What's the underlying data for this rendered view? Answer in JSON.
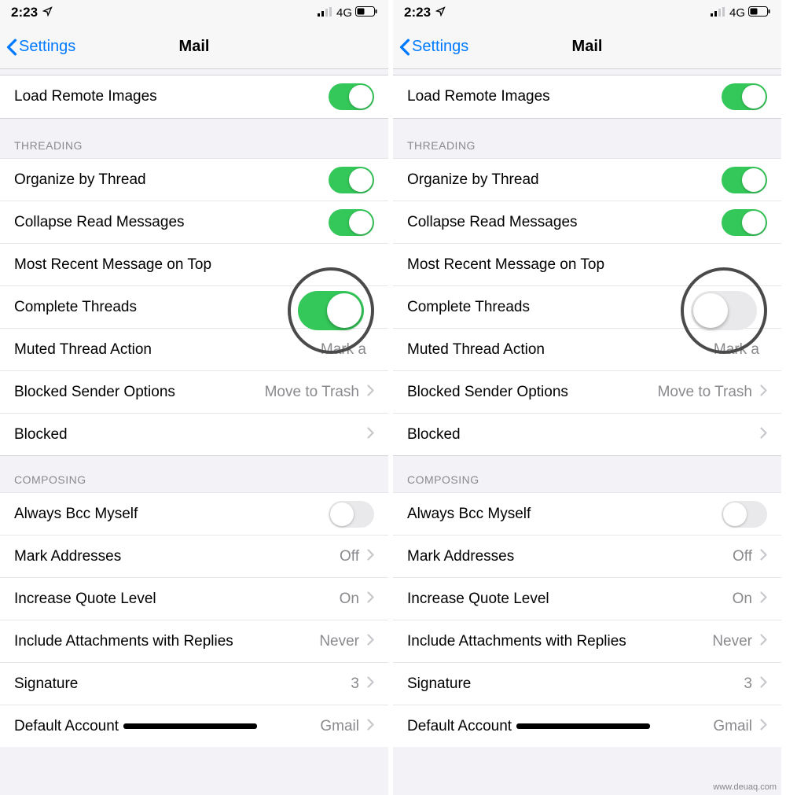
{
  "status": {
    "time": "2:23",
    "network": "4G"
  },
  "nav": {
    "back": "Settings",
    "title": "Mail"
  },
  "rows": {
    "load_remote": "Load Remote Images",
    "organize": "Organize by Thread",
    "collapse": "Collapse Read Messages",
    "most_recent": "Most Recent Message on Top",
    "complete": "Complete Threads",
    "muted": "Muted Thread Action",
    "muted_val": "Mark a",
    "blocked_sender": "Blocked Sender Options",
    "blocked_sender_val": "Move to Trash",
    "blocked": "Blocked",
    "bcc": "Always Bcc Myself",
    "mark_addr": "Mark Addresses",
    "mark_addr_val": "Off",
    "quote": "Increase Quote Level",
    "quote_val": "On",
    "attach": "Include Attachments with Replies",
    "attach_val": "Never",
    "sig": "Signature",
    "sig_val": "3",
    "default_acc": "Default Account",
    "default_acc_val": "Gmail"
  },
  "sections": {
    "threading": "THREADING",
    "composing": "COMPOSING"
  },
  "left": {
    "complete_threads_on": true
  },
  "right": {
    "complete_threads_on": false
  },
  "watermark": "www.deuaq.com"
}
